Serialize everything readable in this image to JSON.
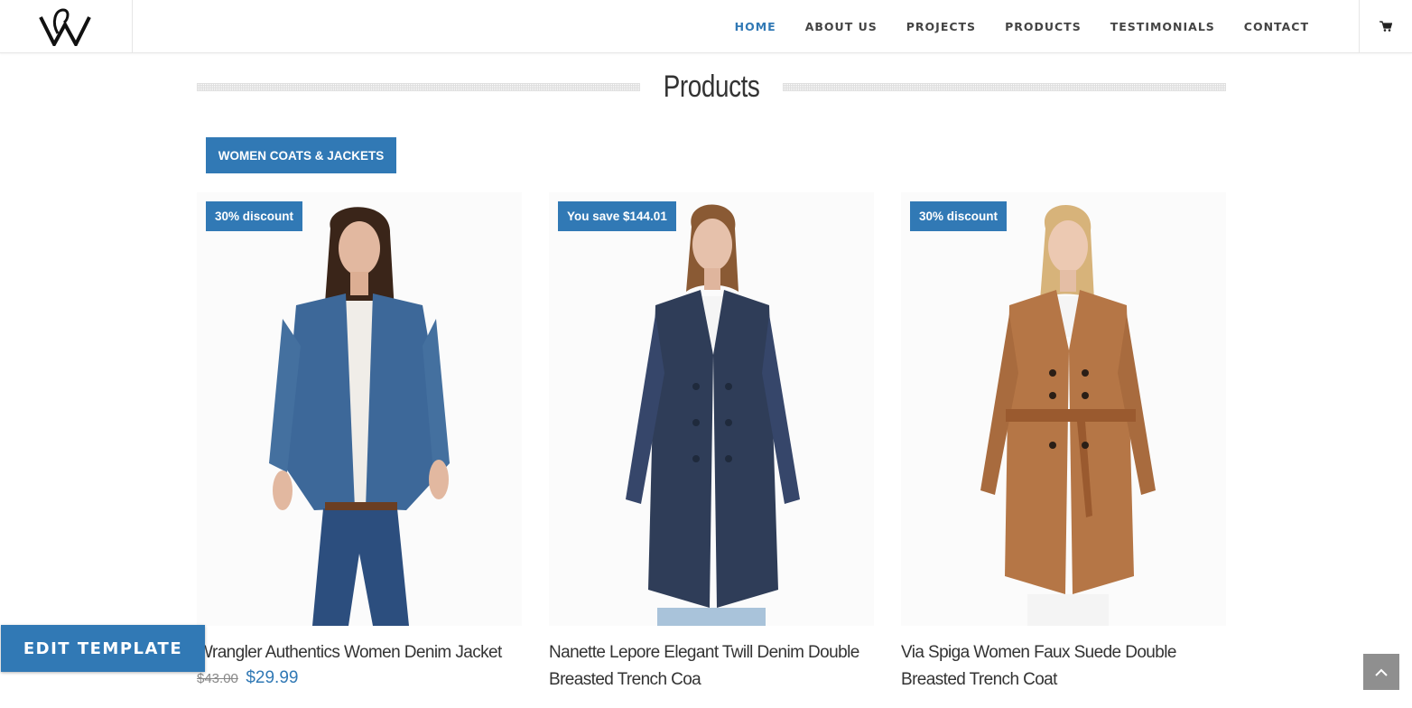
{
  "nav": {
    "items": [
      {
        "label": "HOME",
        "active": true
      },
      {
        "label": "ABOUT US",
        "active": false
      },
      {
        "label": "PROJECTS",
        "active": false
      },
      {
        "label": "PRODUCTS",
        "active": false
      },
      {
        "label": "TESTIMONIALS",
        "active": false
      },
      {
        "label": "CONTACT",
        "active": false
      }
    ],
    "cart_icon": "shopping-cart-icon"
  },
  "section": {
    "title": "Products",
    "category_button": "WOMEN COATS & JACKETS"
  },
  "products": [
    {
      "badge": "30% discount",
      "name": "Wrangler Authentics Women Denim Jacket",
      "old_price": "$43.00",
      "new_price": "$29.99",
      "coat_color": "#3d6899"
    },
    {
      "badge": "You save $144.01",
      "name": "Nanette Lepore Elegant Twill Denim Double Breasted Trench Coa",
      "old_price": "",
      "new_price": "",
      "coat_color": "#2f3d58"
    },
    {
      "badge": "30% discount",
      "name": "Via Spiga Women Faux Suede Double Breasted Trench Coat",
      "old_price": "",
      "new_price": "",
      "coat_color": "#b57646"
    }
  ],
  "edit_template": "EDIT TEMPLATE",
  "colors": {
    "accent": "#3179b5",
    "text": "#333333"
  }
}
